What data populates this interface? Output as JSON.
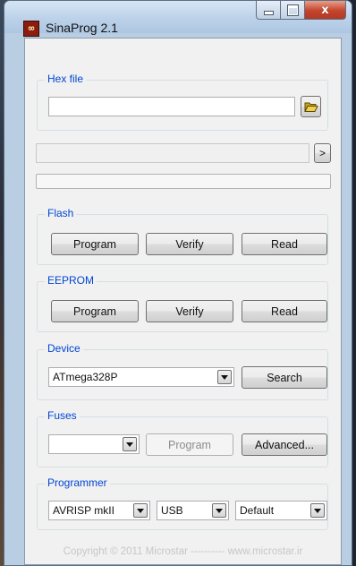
{
  "window": {
    "title": "SinaProg 2.1",
    "icon": "sinaprog-chip-icon",
    "close_glyph": "x"
  },
  "hexfile": {
    "label": "Hex file",
    "path_value": "",
    "browse_icon": "folder-open-icon"
  },
  "status": {
    "text": "",
    "expand_label": ">",
    "progress": 0
  },
  "flash": {
    "label": "Flash",
    "program": "Program",
    "verify": "Verify",
    "read": "Read"
  },
  "eeprom": {
    "label": "EEPROM",
    "program": "Program",
    "verify": "Verify",
    "read": "Read"
  },
  "device": {
    "label": "Device",
    "selected": "ATmega328P",
    "search": "Search"
  },
  "fuses": {
    "label": "Fuses",
    "selected": "",
    "program": "Program",
    "advanced": "Advanced..."
  },
  "programmer": {
    "label": "Programmer",
    "type": "AVRISP mkII",
    "port": "USB",
    "speed": "Default"
  },
  "footer": {
    "text": "Copyright © 2011 Microstar ---------- www.microstar.ir"
  },
  "colors": {
    "group_label": "#0046d5",
    "progress_fill": "#37b72f"
  }
}
